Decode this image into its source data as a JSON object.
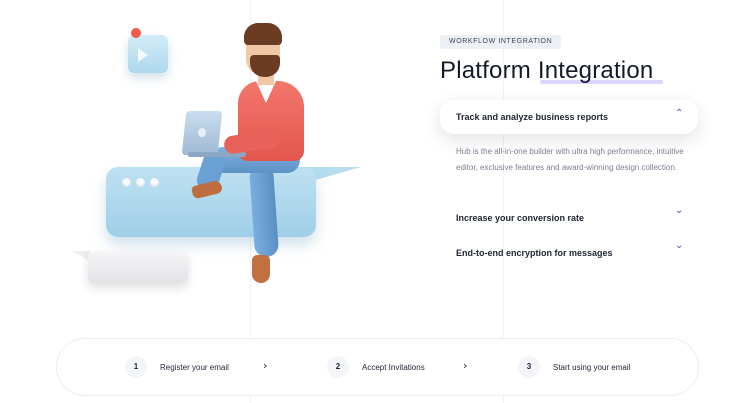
{
  "section": {
    "tag": "WORKFLOW INTEGRATION",
    "title": "Platform Integration"
  },
  "accordion": [
    {
      "title": "Track and analyze business reports",
      "expanded": true,
      "chevron": "⌃",
      "body": "Hub is the all-in-one builder with ultra high performance, intuitive editor, exclusive features and award-winning design collection."
    },
    {
      "title": "Increase your conversion rate",
      "expanded": false,
      "chevron": "⌄"
    },
    {
      "title": "End-to-end encryption for messages",
      "expanded": false,
      "chevron": "⌄"
    }
  ],
  "steps": [
    {
      "number": "1",
      "label": "Register your email"
    },
    {
      "number": "2",
      "label": "Accept Invitations"
    },
    {
      "number": "3",
      "label": "Start using your email"
    }
  ],
  "step_arrow": "›",
  "icons": {
    "mail": "mail-notification-icon",
    "chevron_up": "chevron-up-icon",
    "chevron_down": "chevron-down-icon",
    "arrow": "chevron-right-icon"
  },
  "colors": {
    "accent": "#3a5a9a",
    "title_highlight": "#dcd6fb",
    "tag_bg": "#edf1f6"
  }
}
